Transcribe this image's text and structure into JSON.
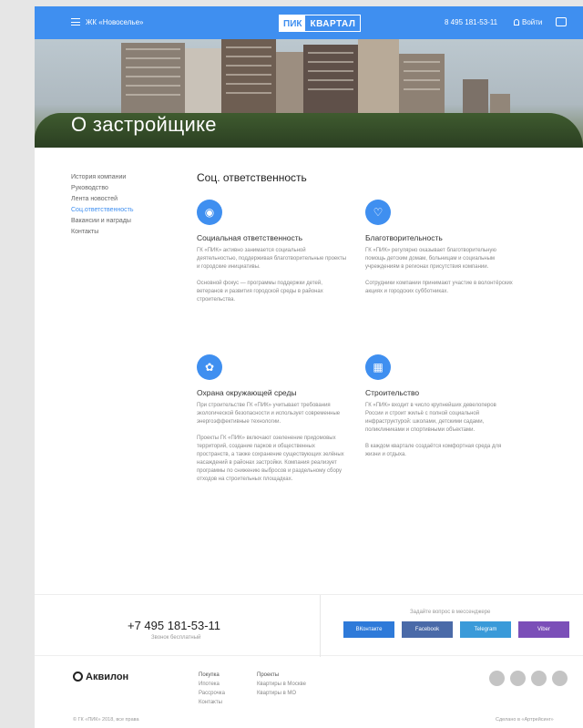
{
  "header": {
    "city": "ЖК «Новоселье»",
    "logo_pik": "ПИК",
    "logo_text": "КВАРТАЛ",
    "phone": "8 495 181-53-11",
    "login": "Войти"
  },
  "hero": {
    "title": "О застройщике"
  },
  "sidebar": {
    "items": [
      {
        "label": "История компании"
      },
      {
        "label": "Руководство"
      },
      {
        "label": "Лента новостей"
      },
      {
        "label": "Соц.ответственность"
      },
      {
        "label": "Вакансии и награды"
      },
      {
        "label": "Контакты"
      }
    ],
    "active_index": 3
  },
  "main": {
    "title": "Соц. ответственность",
    "cards": [
      {
        "icon": "drop-icon",
        "title": "Социальная ответственность",
        "text": "ГК «ПИК» активно занимается социальной деятельностью, поддерживая благотворительные проекты и городские инициативы.\n\nОсновной фокус — программы поддержки детей, ветеранов и развития городской среды в районах строительства."
      },
      {
        "icon": "heart-icon",
        "title": "Благотворительность",
        "text": "ГК «ПИК» регулярно оказывает благотворительную помощь детским домам, больницам и социальным учреждениям в регионах присутствия компании.\n\nСотрудники компании принимают участие в волонтёрских акциях и городских субботниках."
      },
      {
        "icon": "leaf-icon",
        "title": "Охрана окружающей среды",
        "text": "При строительстве ГК «ПИК» учитывает требования экологической безопасности и использует современные энергоэффективные технологии.\n\nПроекты ГК «ПИК» включают озеленение придомовых территорий, создание парков и общественных пространств, а также сохранение существующих зелёных насаждений в районах застройки. Компания реализует программы по снижению выбросов и раздельному сбору отходов на строительных площадках."
      },
      {
        "icon": "building-icon",
        "title": "Строительство",
        "text": "ГК «ПИК» входит в число крупнейших девелоперов России и строит жильё с полной социальной инфраструктурой: школами, детскими садами, поликлиниками и спортивными объектами.\n\nВ каждом квартале создаётся комфортная среда для жизни и отдыха."
      }
    ]
  },
  "contacts": {
    "phone": "+7 495 181-53-11",
    "phone_note": "Звонок бесплатный",
    "question": "Задайте вопрос в мессенджере",
    "messengers": [
      {
        "label": "ВКонтакте",
        "color": "#2e7ad9"
      },
      {
        "label": "Facebook",
        "color": "#4a6aa8"
      },
      {
        "label": "Telegram",
        "color": "#3a9ad9"
      },
      {
        "label": "Viber",
        "color": "#7b4fb8"
      }
    ]
  },
  "footer": {
    "logo": "Аквилон",
    "col1": [
      "Покупка",
      "Ипотека",
      "Рассрочка",
      "Контакты"
    ],
    "col2": [
      "Проекты",
      "Квартиры в Москве",
      "Квартиры в МО"
    ],
    "copyright": "© ГК «ПИК» 2018, все права",
    "made_by": "Сделано в «Артрейсинг»"
  },
  "colors": {
    "accent": "#3f8ff0"
  }
}
